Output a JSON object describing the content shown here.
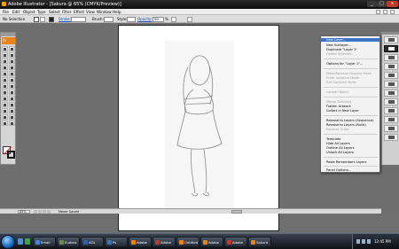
{
  "window": {
    "title": "Adobe Illustrator - [Sakura @ 65% (CMYK/Preview)]",
    "controls": {
      "minimize": "_",
      "maximize": "□",
      "close": "x"
    }
  },
  "menubar": {
    "items": [
      "File",
      "Edit",
      "Object",
      "Type",
      "Select",
      "Filter",
      "Effect",
      "View",
      "Window",
      "Help"
    ]
  },
  "control_bar": {
    "selection": "No Selection",
    "stroke_label": "Stroke:",
    "brush_label": "Brush:",
    "style_label": "Style:",
    "opacity_label": "Opacity:",
    "opacity_value": "50",
    "opacity_unit": "%"
  },
  "toolbox": {
    "logo": "Ai"
  },
  "layers_menu": {
    "items": [
      {
        "label": "New Layer...",
        "state": "highlighted"
      },
      {
        "label": "New Sublayer...",
        "state": "enabled"
      },
      {
        "label": "Duplicate \"Layer 1\"",
        "state": "enabled"
      },
      {
        "label": "Delete Selection",
        "state": "disabled"
      },
      {
        "label": "Options for \"Layer 1\"...",
        "state": "enabled"
      },
      {
        "label": "Make/Release Clipping Mask",
        "state": "disabled"
      },
      {
        "label": "Enter Isolation Mode",
        "state": "disabled"
      },
      {
        "label": "Exit Isolation Mode",
        "state": "disabled"
      },
      {
        "label": "Locate Object",
        "state": "disabled"
      },
      {
        "label": "Merge Selected",
        "state": "disabled"
      },
      {
        "label": "Flatten Artwork",
        "state": "enabled"
      },
      {
        "label": "Collect in New Layer",
        "state": "enabled"
      },
      {
        "label": "Release to Layers (Sequence)",
        "state": "enabled"
      },
      {
        "label": "Release to Layers (Build)",
        "state": "enabled"
      },
      {
        "label": "Reverse Order",
        "state": "disabled"
      },
      {
        "label": "Template",
        "state": "enabled"
      },
      {
        "label": "Hide All Layers",
        "state": "enabled"
      },
      {
        "label": "Outline All Layers",
        "state": "enabled"
      },
      {
        "label": "Unlock All Layers",
        "state": "enabled"
      },
      {
        "label": "Paste Remembers Layers",
        "state": "enabled"
      },
      {
        "label": "Panel Options...",
        "state": "enabled"
      }
    ]
  },
  "status_bar": {
    "zoom": "65%",
    "status": "Never Saved"
  },
  "taskbar": {
    "buttons": [
      {
        "label": "Email",
        "color": "#3f87d8"
      },
      {
        "label": "Eudora",
        "color": "#6b8e3a"
      },
      {
        "label": "AOL",
        "color": "#2f5fb0"
      },
      {
        "label": "Ps",
        "color": "#2d7ac9"
      },
      {
        "label": "Adobe",
        "color": "#e8841a"
      },
      {
        "label": "Adobe",
        "color": "#c0392b"
      },
      {
        "label": "Untitled",
        "color": "#e8841a"
      },
      {
        "label": "Adobe",
        "color": "#e8841a"
      },
      {
        "label": "Adobe",
        "color": "#c0392b"
      },
      {
        "label": "Sakura",
        "color": "#e8841a"
      }
    ],
    "clock": "12:45 PM"
  }
}
